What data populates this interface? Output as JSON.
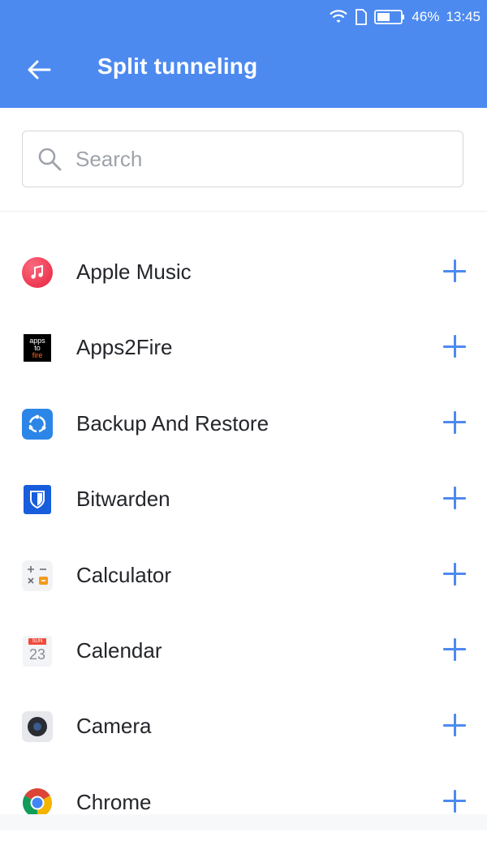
{
  "status_bar": {
    "battery": "46%",
    "time": "13:45",
    "icons": [
      "wifi-icon",
      "sim-icon",
      "battery-icon"
    ]
  },
  "app_bar": {
    "title": "Split tunneling",
    "back_icon": "arrow-left-icon"
  },
  "search": {
    "placeholder": "Search",
    "value": "",
    "icon": "search-icon"
  },
  "apps": [
    {
      "name": "Apple Music",
      "icon": "apple-music-icon"
    },
    {
      "name": "Apps2Fire",
      "icon": "apps2fire-icon",
      "icon_text": [
        "apps",
        "to",
        "fire"
      ]
    },
    {
      "name": "Backup And Restore",
      "icon": "backup-restore-icon"
    },
    {
      "name": "Bitwarden",
      "icon": "bitwarden-icon"
    },
    {
      "name": "Calculator",
      "icon": "calculator-icon"
    },
    {
      "name": "Calendar",
      "icon": "calendar-icon",
      "icon_text": [
        "SUN",
        "23"
      ]
    },
    {
      "name": "Camera",
      "icon": "camera-icon"
    },
    {
      "name": "Chrome",
      "icon": "chrome-icon"
    }
  ],
  "colors": {
    "accent": "#4d8af0",
    "text": "#24262b",
    "placeholder": "#9ea3aa"
  }
}
